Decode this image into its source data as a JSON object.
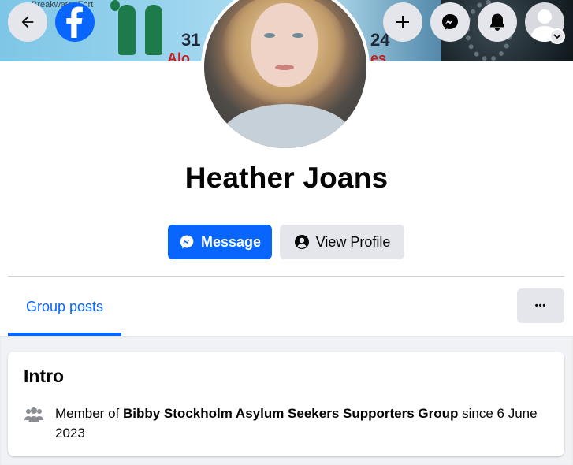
{
  "cover": {
    "map_label": "Breakwater Fort",
    "number_left": "31",
    "number_right": "24",
    "red_left": "Alo",
    "red_right": "es"
  },
  "topbar": {
    "back_icon": "arrow-left-icon",
    "logo_icon": "facebook-logo-icon",
    "create_icon": "plus-icon",
    "messenger_icon": "messenger-icon",
    "notifications_icon": "bell-icon",
    "account_icon": "avatar-icon",
    "account_menu_icon": "chevron-down-icon"
  },
  "profile": {
    "name": "Heather Joans"
  },
  "actions": {
    "message_label": "Message",
    "view_profile_label": "View Profile"
  },
  "tabs": {
    "group_posts_label": "Group posts",
    "more_label": "•••"
  },
  "intro": {
    "title": "Intro",
    "prefix": "Member of ",
    "group_name": "Bibby Stockholm Asylum Seekers Supporters Group",
    "suffix": " since 6 June 2023"
  },
  "colors": {
    "primary": "#0866ff",
    "secondary_bg": "#e4e6eb",
    "page_bg": "#f0f2f5",
    "text": "#050505"
  }
}
